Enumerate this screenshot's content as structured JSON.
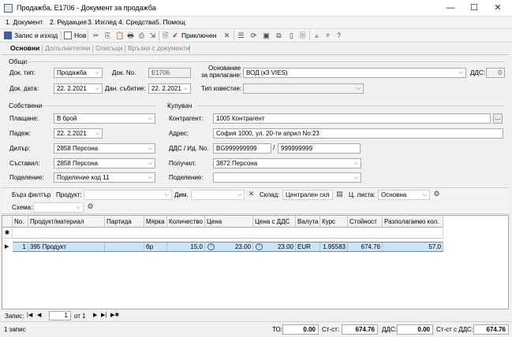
{
  "window": {
    "title": "Продажба, Е1706 - Документ за продажба",
    "minimize_glyph": "—",
    "maximize_glyph": "☐",
    "close_glyph": "✕"
  },
  "menu": [
    "1. Документ",
    "2. Редакция",
    "3. Изглед",
    "4. Средства",
    "5. Помощ"
  ],
  "toolbar": {
    "save_exit": "Запис и изход",
    "new": "Нов",
    "conclude": "Приключен"
  },
  "tabs": [
    "Основни",
    "Допълнителни",
    "Списъци",
    "Връзки с документи"
  ],
  "general": {
    "group": "Общи",
    "doc_type_label": "Док. тип:",
    "doc_type": "Продажба",
    "doc_no_label": "Док. No.",
    "doc_no": "Е1706",
    "doc_date_label": "Док. дата:",
    "doc_date": "22.  2.2021",
    "tax_event_label": "Дан. събитие:",
    "tax_event": "22.  2.2021",
    "basis_label_1": "Основание",
    "basis_label_2": "за прилагане:",
    "basis": "ВОД (к3 VIES)",
    "notice_type_label": "Тип известие:",
    "notice_type": "",
    "vat_label": "ДДС:",
    "vat": "0"
  },
  "own": {
    "group": "Собствени",
    "payment_label": "Плащане:",
    "payment": "В брой",
    "due_label": "Падеж:",
    "due": "22.  2.2021",
    "dealer_label": "Дилър:",
    "dealer": "2858 Персона",
    "composer_label": "Съставил:",
    "composer": "2858 Персона",
    "division_label": "Поделение:",
    "division": "Поделение код 11"
  },
  "buyer": {
    "group": "Купувач",
    "contractor_label": "Контрагент:",
    "contractor": "1005 Контрагент",
    "address_label": "Адрес:",
    "address": "София 1000, ул. 20-ти април No:23",
    "vat_id_label": "ДДС / Ид. No.",
    "vat_no": "BG999999999",
    "id_sep": "/",
    "id_no": "999999999",
    "receiver_label": "Получил:",
    "receiver": "3872 Персона",
    "division_label": "Поделение:",
    "division": "",
    "ellipsis": "..."
  },
  "filter": {
    "quick_label": "Бърз филтър",
    "product_label": "Продукт:",
    "product": "",
    "dim_label": "Дим.",
    "dim": "",
    "warehouse_label": "Склад:",
    "warehouse": "Централен скл",
    "price_list_label": "Ц. листа:",
    "price_list": "Основна",
    "scheme_label": "Схема:",
    "scheme": ""
  },
  "grid": {
    "columns": [
      "No.",
      "Продукт/материал",
      "Партида",
      "Мярка",
      "Количество",
      "Цена",
      "Цена с ДДС",
      "Валута",
      "Курс",
      "Стойност",
      "Разполагаемо кол."
    ],
    "new_row_marker": "✱",
    "current_row_marker": "▶",
    "rows": [
      {
        "no": "1",
        "product": "395 Продукт",
        "batch": "",
        "unit": "бр",
        "qty": "15.0",
        "price": "23.00",
        "price_vat": "23.00",
        "currency": "EUR",
        "rate": "1.95583",
        "value": "674.76",
        "available": "57.0"
      }
    ]
  },
  "record": {
    "label": "Запис:",
    "current": "1",
    "of": "от 1"
  },
  "status": {
    "left": "1 запис",
    "to_label": "ТО:",
    "to": "0.00",
    "value_label": "Ст-ст:",
    "value": "674.76",
    "vat_label": "ДДС:",
    "vat": "0.00",
    "total_label": "Ст-ст с ДДС:",
    "total": "674.76"
  }
}
